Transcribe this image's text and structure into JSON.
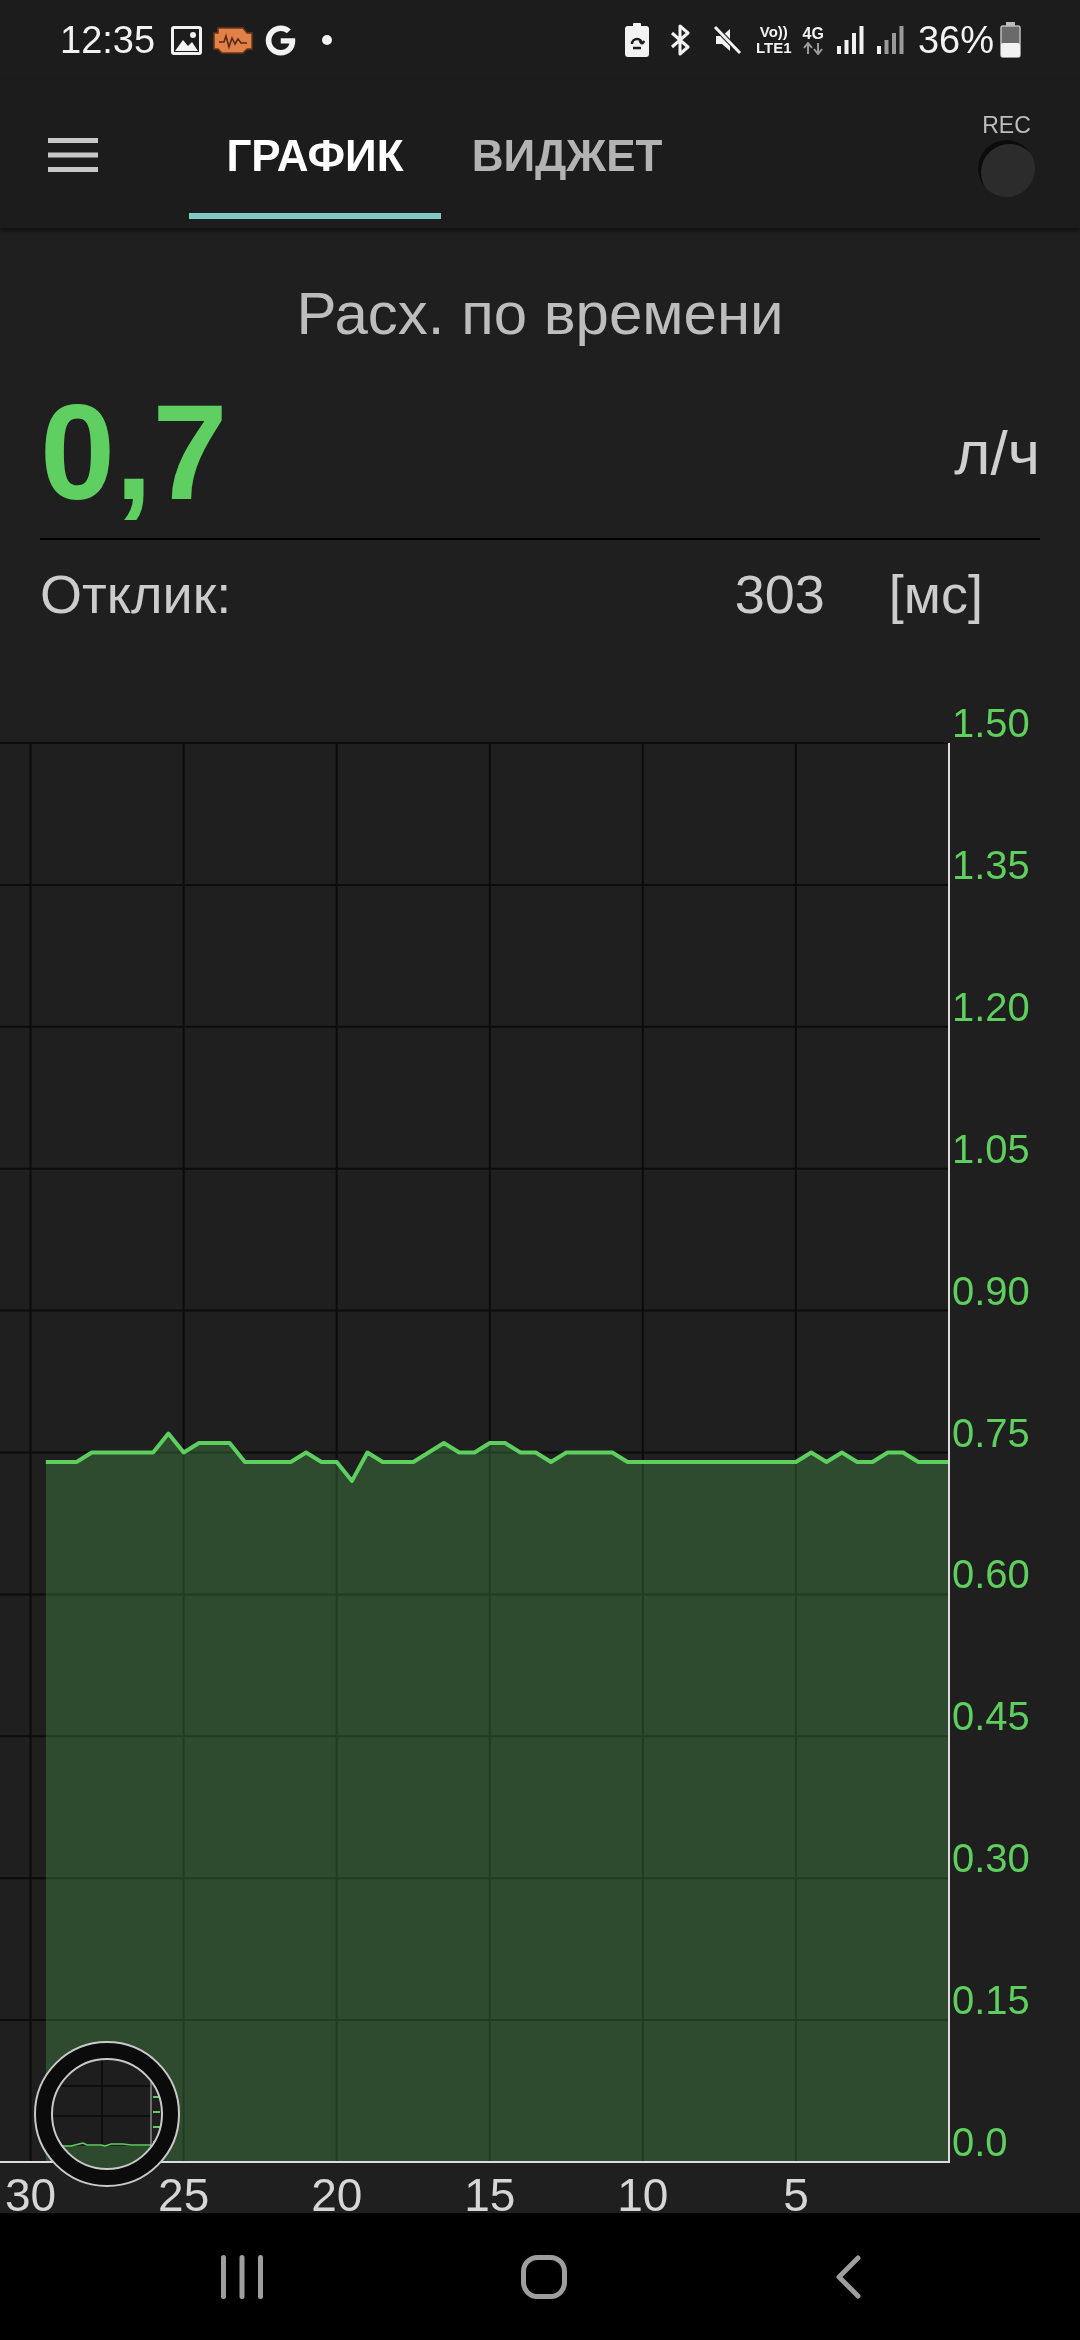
{
  "status_bar": {
    "time": "12:35",
    "volte_top": "Vo))",
    "volte_bottom": "LTE1",
    "network": "4G",
    "battery": "36%"
  },
  "tabs": [
    {
      "label": "ГРАФИК",
      "selected": true
    },
    {
      "label": "ВИДЖЕТ",
      "selected": false
    }
  ],
  "record": {
    "label": "REC"
  },
  "gauge": {
    "title": "Расх. по времени",
    "value": "0,7",
    "unit": "л/ч"
  },
  "response": {
    "label": "Отклик:",
    "value": "303",
    "unit": "[мс]"
  },
  "chart": {
    "chart_data": {
      "type": "area",
      "grid": true,
      "x": [
        29.5,
        29,
        28.5,
        28,
        27.5,
        27,
        26.5,
        26,
        25.5,
        25,
        24.5,
        24,
        23.5,
        23,
        22.5,
        22,
        21.5,
        21,
        20.5,
        20,
        19.5,
        19,
        18.5,
        18,
        17.5,
        17,
        16.5,
        16,
        15.5,
        15,
        14.5,
        14,
        13.5,
        13,
        12.5,
        12,
        11.5,
        11,
        10.5,
        10,
        9.5,
        9,
        8.5,
        8,
        7.5,
        7,
        6.5,
        6,
        5.5,
        5,
        4.5,
        4,
        3.5,
        3,
        2.5,
        2,
        1.5,
        1,
        0.5,
        0
      ],
      "series": [
        {
          "color": "#5ecf5e",
          "values": [
            0.74,
            0.74,
            0.74,
            0.75,
            0.75,
            0.75,
            0.75,
            0.75,
            0.77,
            0.75,
            0.76,
            0.76,
            0.76,
            0.74,
            0.74,
            0.74,
            0.74,
            0.75,
            0.74,
            0.74,
            0.72,
            0.75,
            0.74,
            0.74,
            0.74,
            0.75,
            0.76,
            0.75,
            0.75,
            0.76,
            0.76,
            0.75,
            0.75,
            0.74,
            0.75,
            0.75,
            0.75,
            0.75,
            0.74,
            0.74,
            0.74,
            0.74,
            0.74,
            0.74,
            0.74,
            0.74,
            0.74,
            0.74,
            0.74,
            0.74,
            0.75,
            0.74,
            0.75,
            0.74,
            0.74,
            0.75,
            0.75,
            0.74,
            0.74,
            0.74
          ]
        }
      ],
      "xlim": [
        31,
        0
      ],
      "ylim": [
        0,
        1.5
      ],
      "xticks": [
        30,
        25,
        20,
        15,
        10,
        5
      ],
      "yticks": [
        {
          "value": 1.5,
          "label": "1.50"
        },
        {
          "value": 1.35,
          "label": "1.35"
        },
        {
          "value": 1.2,
          "label": "1.20"
        },
        {
          "value": 1.05,
          "label": "1.05"
        },
        {
          "value": 0.9,
          "label": "0.90"
        },
        {
          "value": 0.75,
          "label": "0.75"
        },
        {
          "value": 0.6,
          "label": "0.60"
        },
        {
          "value": 0.45,
          "label": "0.45"
        },
        {
          "value": 0.3,
          "label": "0.30"
        },
        {
          "value": 0.15,
          "label": "0.15"
        },
        {
          "value": 0,
          "label": "0.0"
        }
      ]
    }
  }
}
